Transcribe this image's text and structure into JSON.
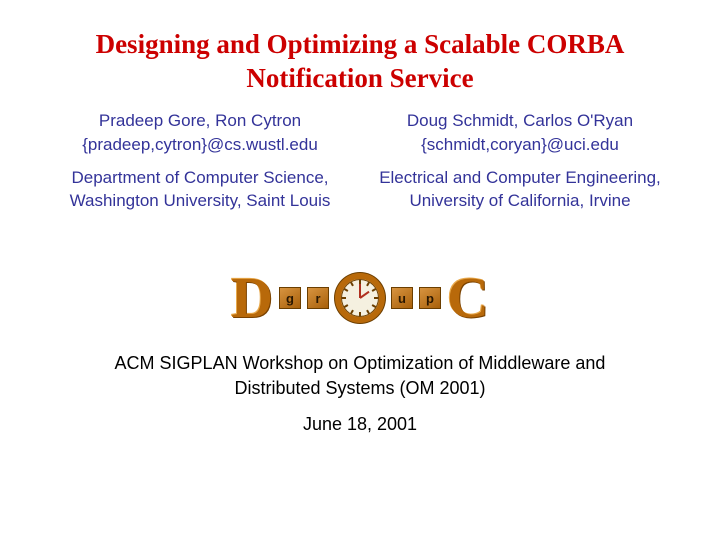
{
  "title": "Designing and Optimizing a Scalable CORBA Notification Service",
  "authors": {
    "left": {
      "names": "Pradeep Gore, Ron Cytron",
      "email": "{pradeep,cytron}@cs.wustl.edu",
      "dept": "Department of Computer Science, Washington University, Saint Louis"
    },
    "right": {
      "names": "Doug Schmidt, Carlos O'Ryan",
      "email": "{schmidt,coryan}@uci.edu",
      "dept": "Electrical and Computer Engineering, University of California, Irvine"
    }
  },
  "logo": {
    "letters": [
      "D",
      "C"
    ],
    "small": [
      "g",
      "r",
      "u",
      "p"
    ],
    "center_icon": "clock-icon"
  },
  "footer": {
    "venue": "ACM SIGPLAN Workshop on Optimization of Middleware and Distributed Systems (OM 2001)",
    "date": "June 18, 2001"
  }
}
